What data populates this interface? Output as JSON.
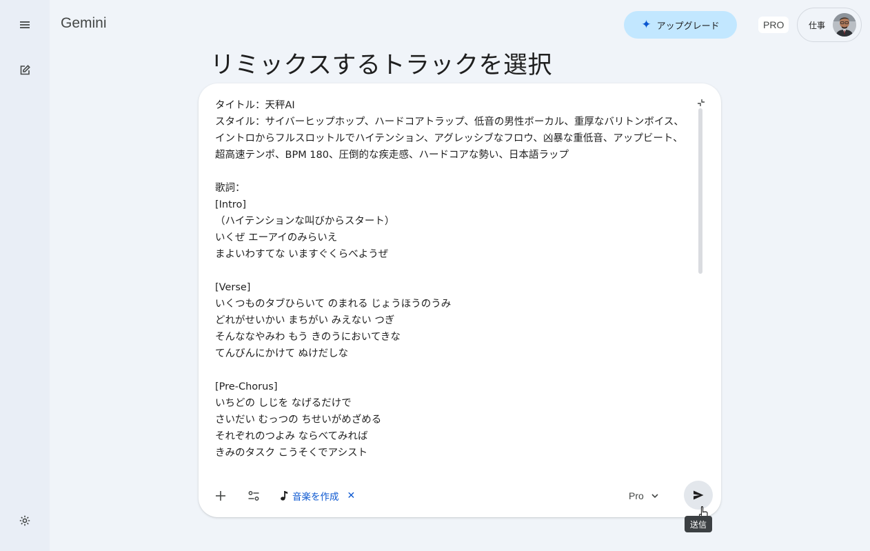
{
  "app": {
    "title": "Gemini"
  },
  "header": {
    "upgrade_label": "アップグレード",
    "pro_badge": "PRO",
    "account_label": "仕事"
  },
  "main": {
    "heading": "リミックスするトラックを選択"
  },
  "composer": {
    "text": "タイトル：天秤AI\nスタイル：サイバーヒップホップ、ハードコアトラップ、低音の男性ボーカル、重厚なバリトンボイス、イントロからフルスロットルでハイテンション、アグレッシブなフロウ、凶暴な重低音、アップビート、超高速テンポ、BPM 180、圧倒的な疾走感、ハードコアな勢い、日本語ラップ\n\n歌詞：\n[Intro]\n（ハイテンションな叫びからスタート）\nいくぜ エーアイのみらいえ\nまよいわすてな いますぐくらべようぜ\n\n[Verse]\nいくつものタブひらいて のまれる じょうほうのうみ\nどれがせいかい まちがい みえない つぎ\nそんななやみわ もう きのうにおいてきな\nてんびんにかけて ぬけだしな\n\n[Pre-Chorus]\nいちどの しじを なげるだけで\nさいだい むっつの ちせいがめざめる\nそれぞれのつよみ ならべてみれば\nきみのタスク こうそくでアシスト",
    "chip_label": "音楽を作成",
    "model_label": "Pro",
    "send_tooltip": "送信"
  },
  "icons": {
    "rail": [
      "menu-icon",
      "new-chat-icon",
      "settings-icon"
    ],
    "toolbar": [
      "add-icon",
      "tools-icon",
      "music-note-icon",
      "close-icon",
      "chevron-down-icon",
      "send-icon"
    ]
  },
  "colors": {
    "background": "#f0f4f9",
    "rail": "#e9eef6",
    "upgrade_bg": "#c2e7ff",
    "accent": "#0b57d0",
    "tooltip_bg": "#3c4043"
  }
}
